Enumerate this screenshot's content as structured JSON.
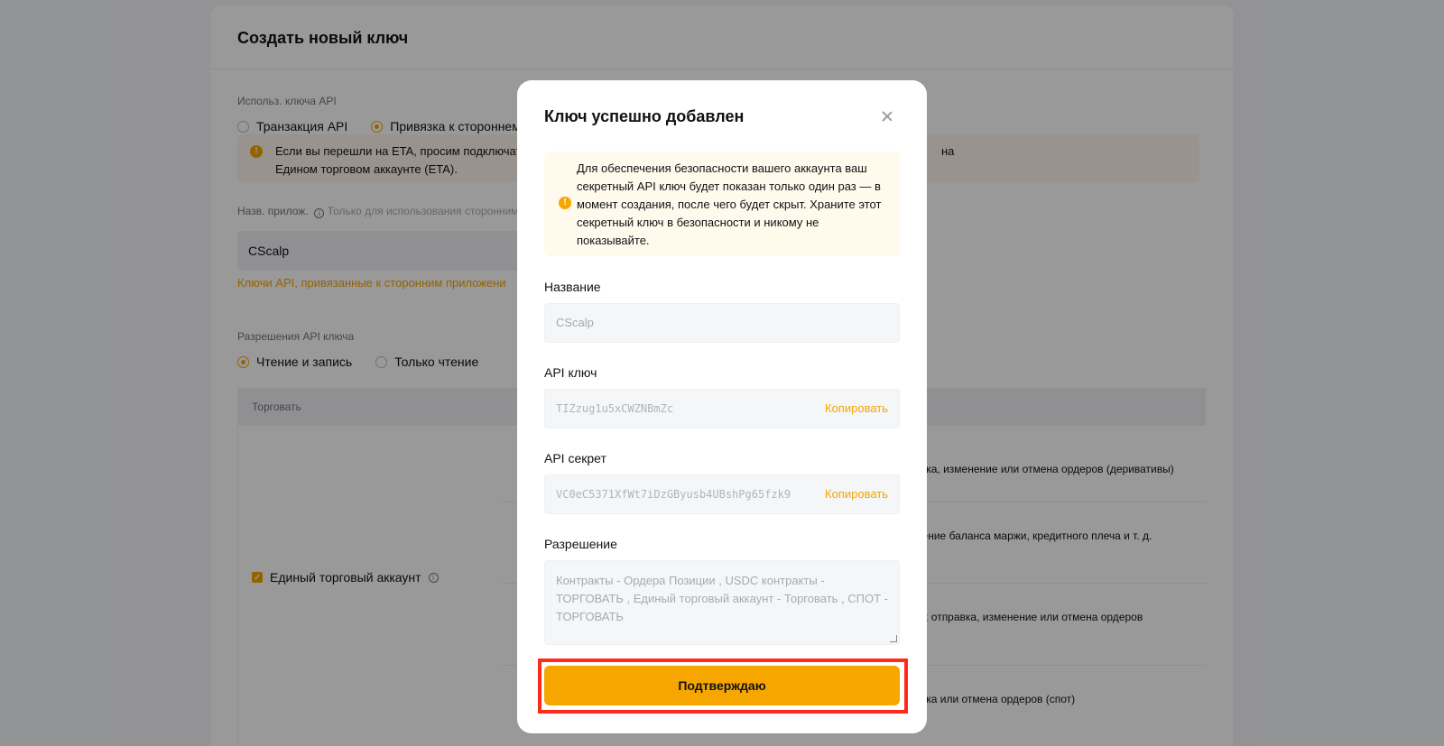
{
  "page": {
    "title": "Создать новый ключ",
    "usage_label": "Использ. ключа API",
    "usage_options": [
      "Транзакция API",
      "Привязка к стороннему п"
    ],
    "eta_notice_line1": "Если вы перешли на ETA, просим подключат",
    "eta_notice_tail": "на",
    "eta_notice_line2": "Едином торговом аккаунте (ETA).",
    "app_name_label": "Назв. прилож.",
    "app_name_hint": "Только для использования сторонними",
    "app_name_value": "CScalp",
    "third_party_link": "Ключи API, привязанные к сторонним приложени",
    "permissions_label": "Разрешения API ключа",
    "permission_modes": [
      "Чтение и запись",
      "Только чтение"
    ],
    "table_header": "Торговать",
    "unified_account_label": "Единый торговый аккаунт",
    "perm_rows": [
      "правка, изменение или отмена ордеров (деривативы)",
      "менение баланса маржи, кредитного плеча и т. д.",
      "тиве; отправка, изменение или отмена ордеров",
      "правка или отмена ордеров (спот)"
    ]
  },
  "modal": {
    "title": "Ключ успешно добавлен",
    "warning": "Для обеспечения безопасности вашего аккаунта ваш секретный API ключ будет показан только один раз — в момент создания, после чего будет скрыт. Храните этот секретный ключ в безопасности и никому не показывайте.",
    "name_label": "Название",
    "name_value": "CScalp",
    "api_key_label": "API ключ",
    "api_key_value": "TIZzug1u5xCWZNBmZc",
    "api_secret_label": "API секрет",
    "api_secret_value": "VC0eC5371XfWt7iDzGByusb4UBshPg65fzk9",
    "copy_label": "Копировать",
    "permission_label": "Разрешение",
    "permission_value": "Контракты - Ордера Позиции  , USDC контракты - ТОРГОВАТЬ  , Единый торговый аккаунт - Торговать  , СПОТ - ТОРГОВАТЬ",
    "confirm_label": "Подтверждаю"
  },
  "colors": {
    "accent": "#f7a600",
    "highlight_frame": "#ff2a1a"
  }
}
